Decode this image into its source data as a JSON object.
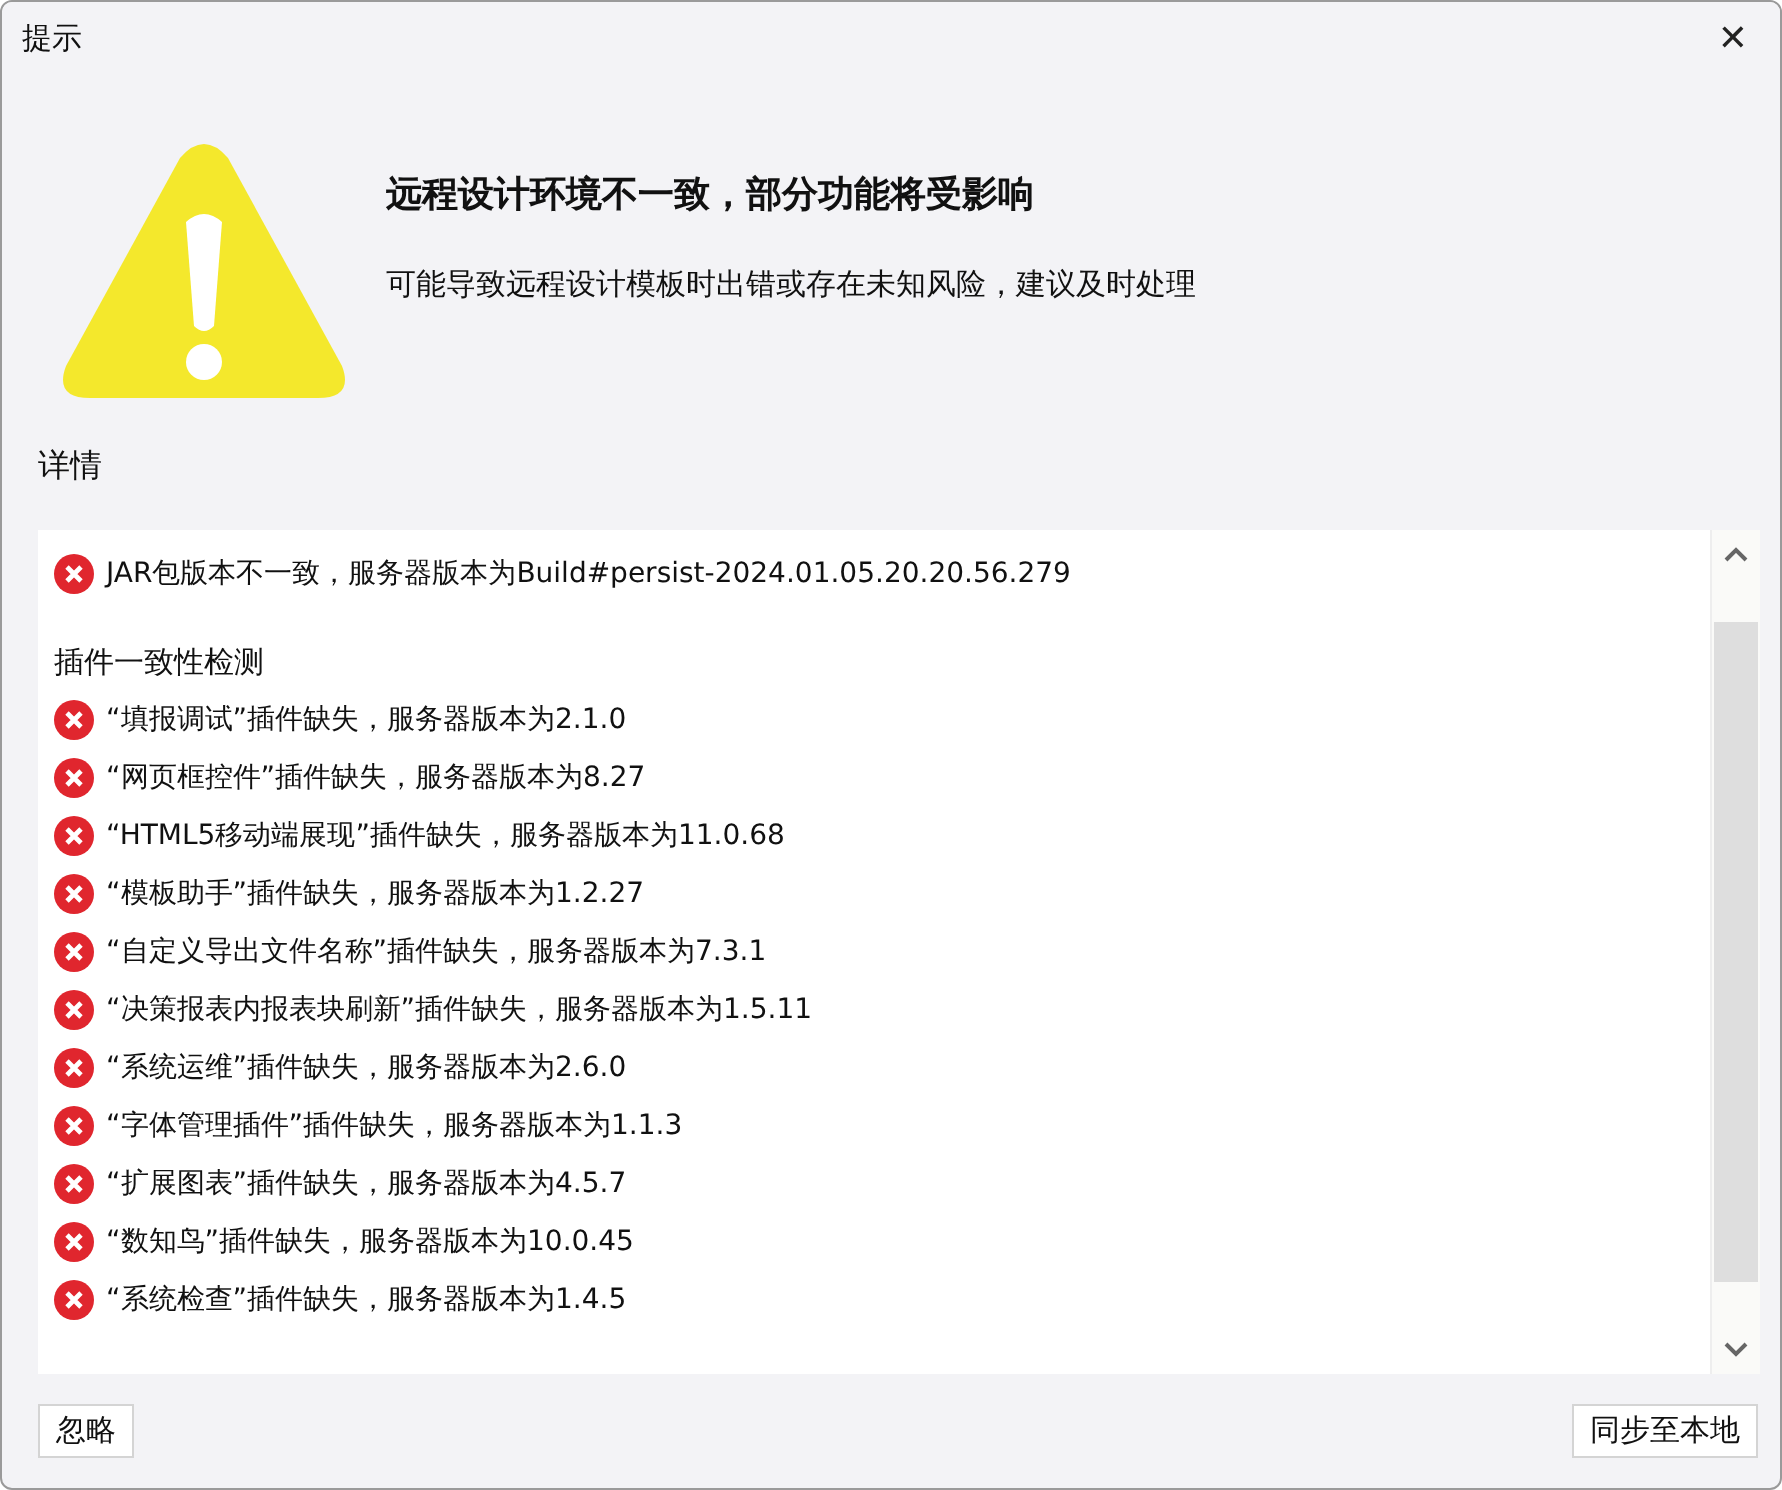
{
  "window": {
    "title": "提示",
    "close": "✕"
  },
  "message": {
    "heading": "远程设计环境不一致，部分功能将受影响",
    "body": "可能导致远程设计模板时出错或存在未知风险，建议及时处理"
  },
  "details_label": "详情",
  "details": [
    {
      "kind": "error",
      "text": "JAR包版本不一致，服务器版本为Build#persist-2024.01.05.20.20.56.279"
    },
    {
      "kind": "heading",
      "text": "插件一致性检测"
    },
    {
      "kind": "error",
      "text": "“填报调试”插件缺失，服务器版本为2.1.0"
    },
    {
      "kind": "error",
      "text": "“网页框控件”插件缺失，服务器版本为8.27"
    },
    {
      "kind": "error",
      "text": "“HTML5移动端展现”插件缺失，服务器版本为11.0.68"
    },
    {
      "kind": "error",
      "text": "“模板助手”插件缺失，服务器版本为1.2.27"
    },
    {
      "kind": "error",
      "text": "“自定义导出文件名称”插件缺失，服务器版本为7.3.1"
    },
    {
      "kind": "error",
      "text": "“决策报表内报表块刷新”插件缺失，服务器版本为1.5.11"
    },
    {
      "kind": "error",
      "text": "“系统运维”插件缺失，服务器版本为2.6.0"
    },
    {
      "kind": "error",
      "text": "“字体管理插件”插件缺失，服务器版本为1.1.3"
    },
    {
      "kind": "error",
      "text": "“扩展图表”插件缺失，服务器版本为4.5.7"
    },
    {
      "kind": "error",
      "text": "“数知鸟”插件缺失，服务器版本为10.0.45"
    },
    {
      "kind": "error",
      "text": "“系统检查”插件缺失，服务器版本为1.4.5"
    }
  ],
  "buttons": {
    "left": "忽略",
    "right": "同步至本地"
  }
}
